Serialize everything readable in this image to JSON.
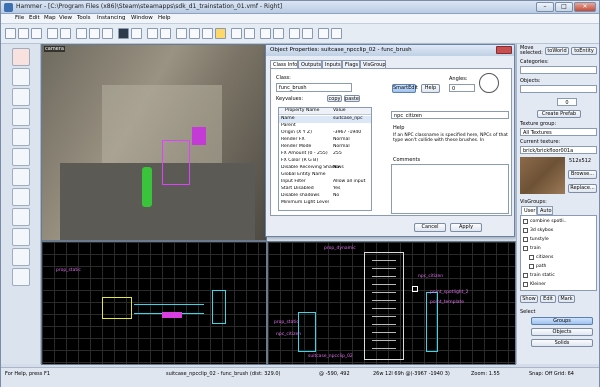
{
  "window": {
    "title": "Hammer - [C:\\Program Files (x86)\\Steam\\steamapps\\sdk_d1_trainstation_01.vmf - Right]"
  },
  "menu": [
    "File",
    "Edit",
    "Map",
    "View",
    "Tools",
    "Instancing",
    "Window",
    "Help"
  ],
  "viewport_3d": {
    "label": "camera"
  },
  "viewport_top_labels": [
    "prop_static"
  ],
  "viewport_side_labels": [
    "prop_dynamic",
    "npc_citizen",
    "point_spotlight_2",
    "point_template",
    "prop_static",
    "npc_citizen",
    "suitcase_npcclip_02"
  ],
  "dialog": {
    "title": "Object Properties: suitcase_npcclip_02 - func_brush",
    "tabs": [
      "Class Info",
      "Outputs",
      "Inputs",
      "Flags",
      "VisGroup"
    ],
    "class_label": "Class:",
    "class_value": "func_brush",
    "keyvalues_label": "Keyvalues:",
    "copy_label": "copy",
    "paste_label": "paste",
    "smartedit_label": "SmartEdit",
    "help_label": "Help",
    "angles_label": "Angles:",
    "angles_value": "0",
    "columns": [
      "Property Name",
      "Value"
    ],
    "rows": [
      {
        "name": "Name",
        "value": "suitcase_npc"
      },
      {
        "name": "Parent",
        "value": ""
      },
      {
        "name": "Origin (X Y Z)",
        "value": "-3967 -1940"
      },
      {
        "name": "Render FX",
        "value": "Normal"
      },
      {
        "name": "Render Mode",
        "value": "Normal"
      },
      {
        "name": "FX Amount (0 - 255)",
        "value": "255"
      },
      {
        "name": "FX Color (R G B)",
        "value": ""
      },
      {
        "name": "Disable Receiving Shadows",
        "value": "No"
      },
      {
        "name": "Global Entity Name",
        "value": ""
      },
      {
        "name": "Input Filter",
        "value": "Allow all input"
      },
      {
        "name": "Start Disabled",
        "value": "Yes"
      },
      {
        "name": "Disable shadows",
        "value": "No"
      },
      {
        "name": "Minimum Light Level",
        "value": ""
      }
    ],
    "value_field": "npc_citizen",
    "help_title": "Help",
    "help_text": "If an NPC classname is specified here, NPCs of that type won't collide with these brushes. In",
    "comments_label": "Comments",
    "cancel_label": "Cancel",
    "apply_label": "Apply"
  },
  "right_panel": {
    "move_selected": "Move selected:",
    "to_world": "toWorld",
    "to_entity": "toEntity",
    "categories_label": "Categories:",
    "objects_label": "Objects:",
    "objects_count": "0",
    "create_prefab": "Create Prefab",
    "texture_group_label": "Texture group:",
    "texture_group_value": "All Textures",
    "current_texture_label": "Current texture:",
    "current_texture_value": "brick/brickfloor001a",
    "texture_size": "512x512",
    "browse_label": "Browse...",
    "replace_label": "Replace...",
    "visgroups_label": "VisGroups:",
    "visgroup_tabs": [
      "User",
      "Auto"
    ],
    "tree": [
      "combine spotli..",
      "3d skybox",
      "tunstyle",
      "train",
      "citizens",
      "path",
      "train static",
      "Kleiner"
    ],
    "show_label": "Show",
    "edit_label": "Edit",
    "mark_label": "Mark",
    "select_label": "Select",
    "groups_label": "Groups",
    "objects_btn": "Objects",
    "solids_label": "Solids"
  },
  "status": {
    "help": "For Help, press F1",
    "selection": "suitcase_npcclip_02 - func_brush  (dist: 329.0)",
    "coords": "@ -590, 492",
    "dims": "26w 12l 69h @(-3967 -1940 3)",
    "zoom": "Zoom: 1.55",
    "snap": "Snap: Off Grid: 64"
  }
}
